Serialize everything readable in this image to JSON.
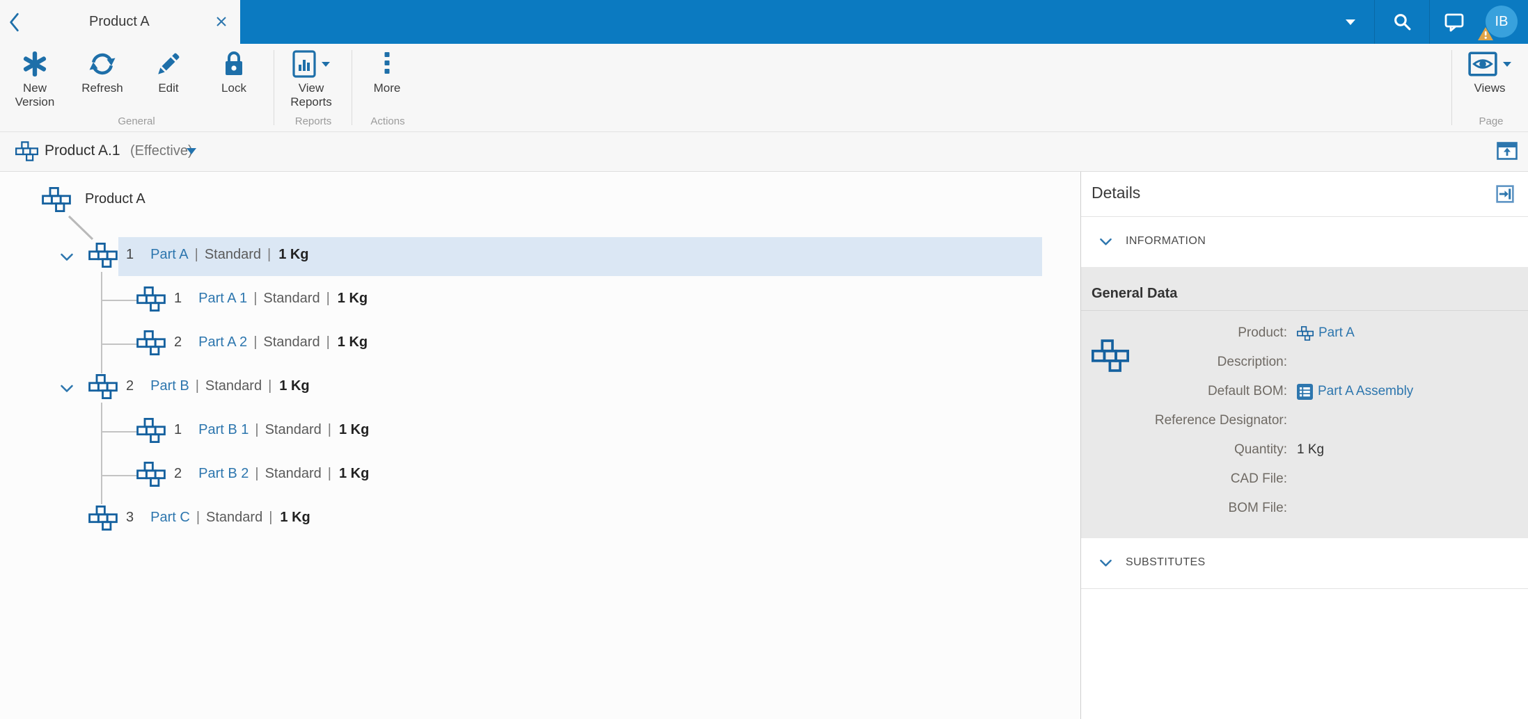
{
  "colors": {
    "topbar_blue": "#0b7ac1",
    "toolbar_icon_blue": "#1e6fa9",
    "part_icon_blue": "#15619f",
    "link_blue": "#2d76ae",
    "selection_bg": "#dbe7f4",
    "warning_orange": "#dda449",
    "avatar_blue": "#38a1dd",
    "gray_panel": "#e9e9e9"
  },
  "topbar": {
    "tab_title": "Product A",
    "avatar_initials": "IB"
  },
  "toolbar": {
    "buttons": {
      "new_version": "New\nVersion",
      "refresh": "Refresh",
      "edit": "Edit",
      "lock": "Lock",
      "view_reports": "View\nReports",
      "more": "More",
      "views": "Views"
    },
    "groups": {
      "general": "General",
      "reports": "Reports",
      "actions": "Actions",
      "page": "Page"
    }
  },
  "breadcrumb": {
    "title": "Product A.1",
    "state": "(Effective)"
  },
  "tree": {
    "root_label": "Product A",
    "separator": "|",
    "rows": [
      {
        "seq": "1",
        "name": "Part A",
        "type": "Standard",
        "qty": "1 Kg"
      },
      {
        "seq": "1",
        "name": "Part A 1",
        "type": "Standard",
        "qty": "1 Kg"
      },
      {
        "seq": "2",
        "name": "Part A 2",
        "type": "Standard",
        "qty": "1 Kg"
      },
      {
        "seq": "2",
        "name": "Part B",
        "type": "Standard",
        "qty": "1 Kg"
      },
      {
        "seq": "1",
        "name": "Part B 1",
        "type": "Standard",
        "qty": "1 Kg"
      },
      {
        "seq": "2",
        "name": "Part B 2",
        "type": "Standard",
        "qty": "1 Kg"
      },
      {
        "seq": "3",
        "name": "Part C",
        "type": "Standard",
        "qty": "1 Kg"
      }
    ]
  },
  "details": {
    "title": "Details",
    "sections": {
      "information": "INFORMATION",
      "substitutes": "SUBSTITUTES"
    },
    "general_data_title": "General Data",
    "fields": [
      {
        "label": "Product:",
        "value": "Part A"
      },
      {
        "label": "Description:",
        "value": ""
      },
      {
        "label": "Default BOM:",
        "value": "Part A Assembly"
      },
      {
        "label": "Reference Designator:",
        "value": ""
      },
      {
        "label": "Quantity:",
        "value": "1 Kg"
      },
      {
        "label": "CAD File:",
        "value": ""
      },
      {
        "label": "BOM File:",
        "value": ""
      }
    ]
  }
}
